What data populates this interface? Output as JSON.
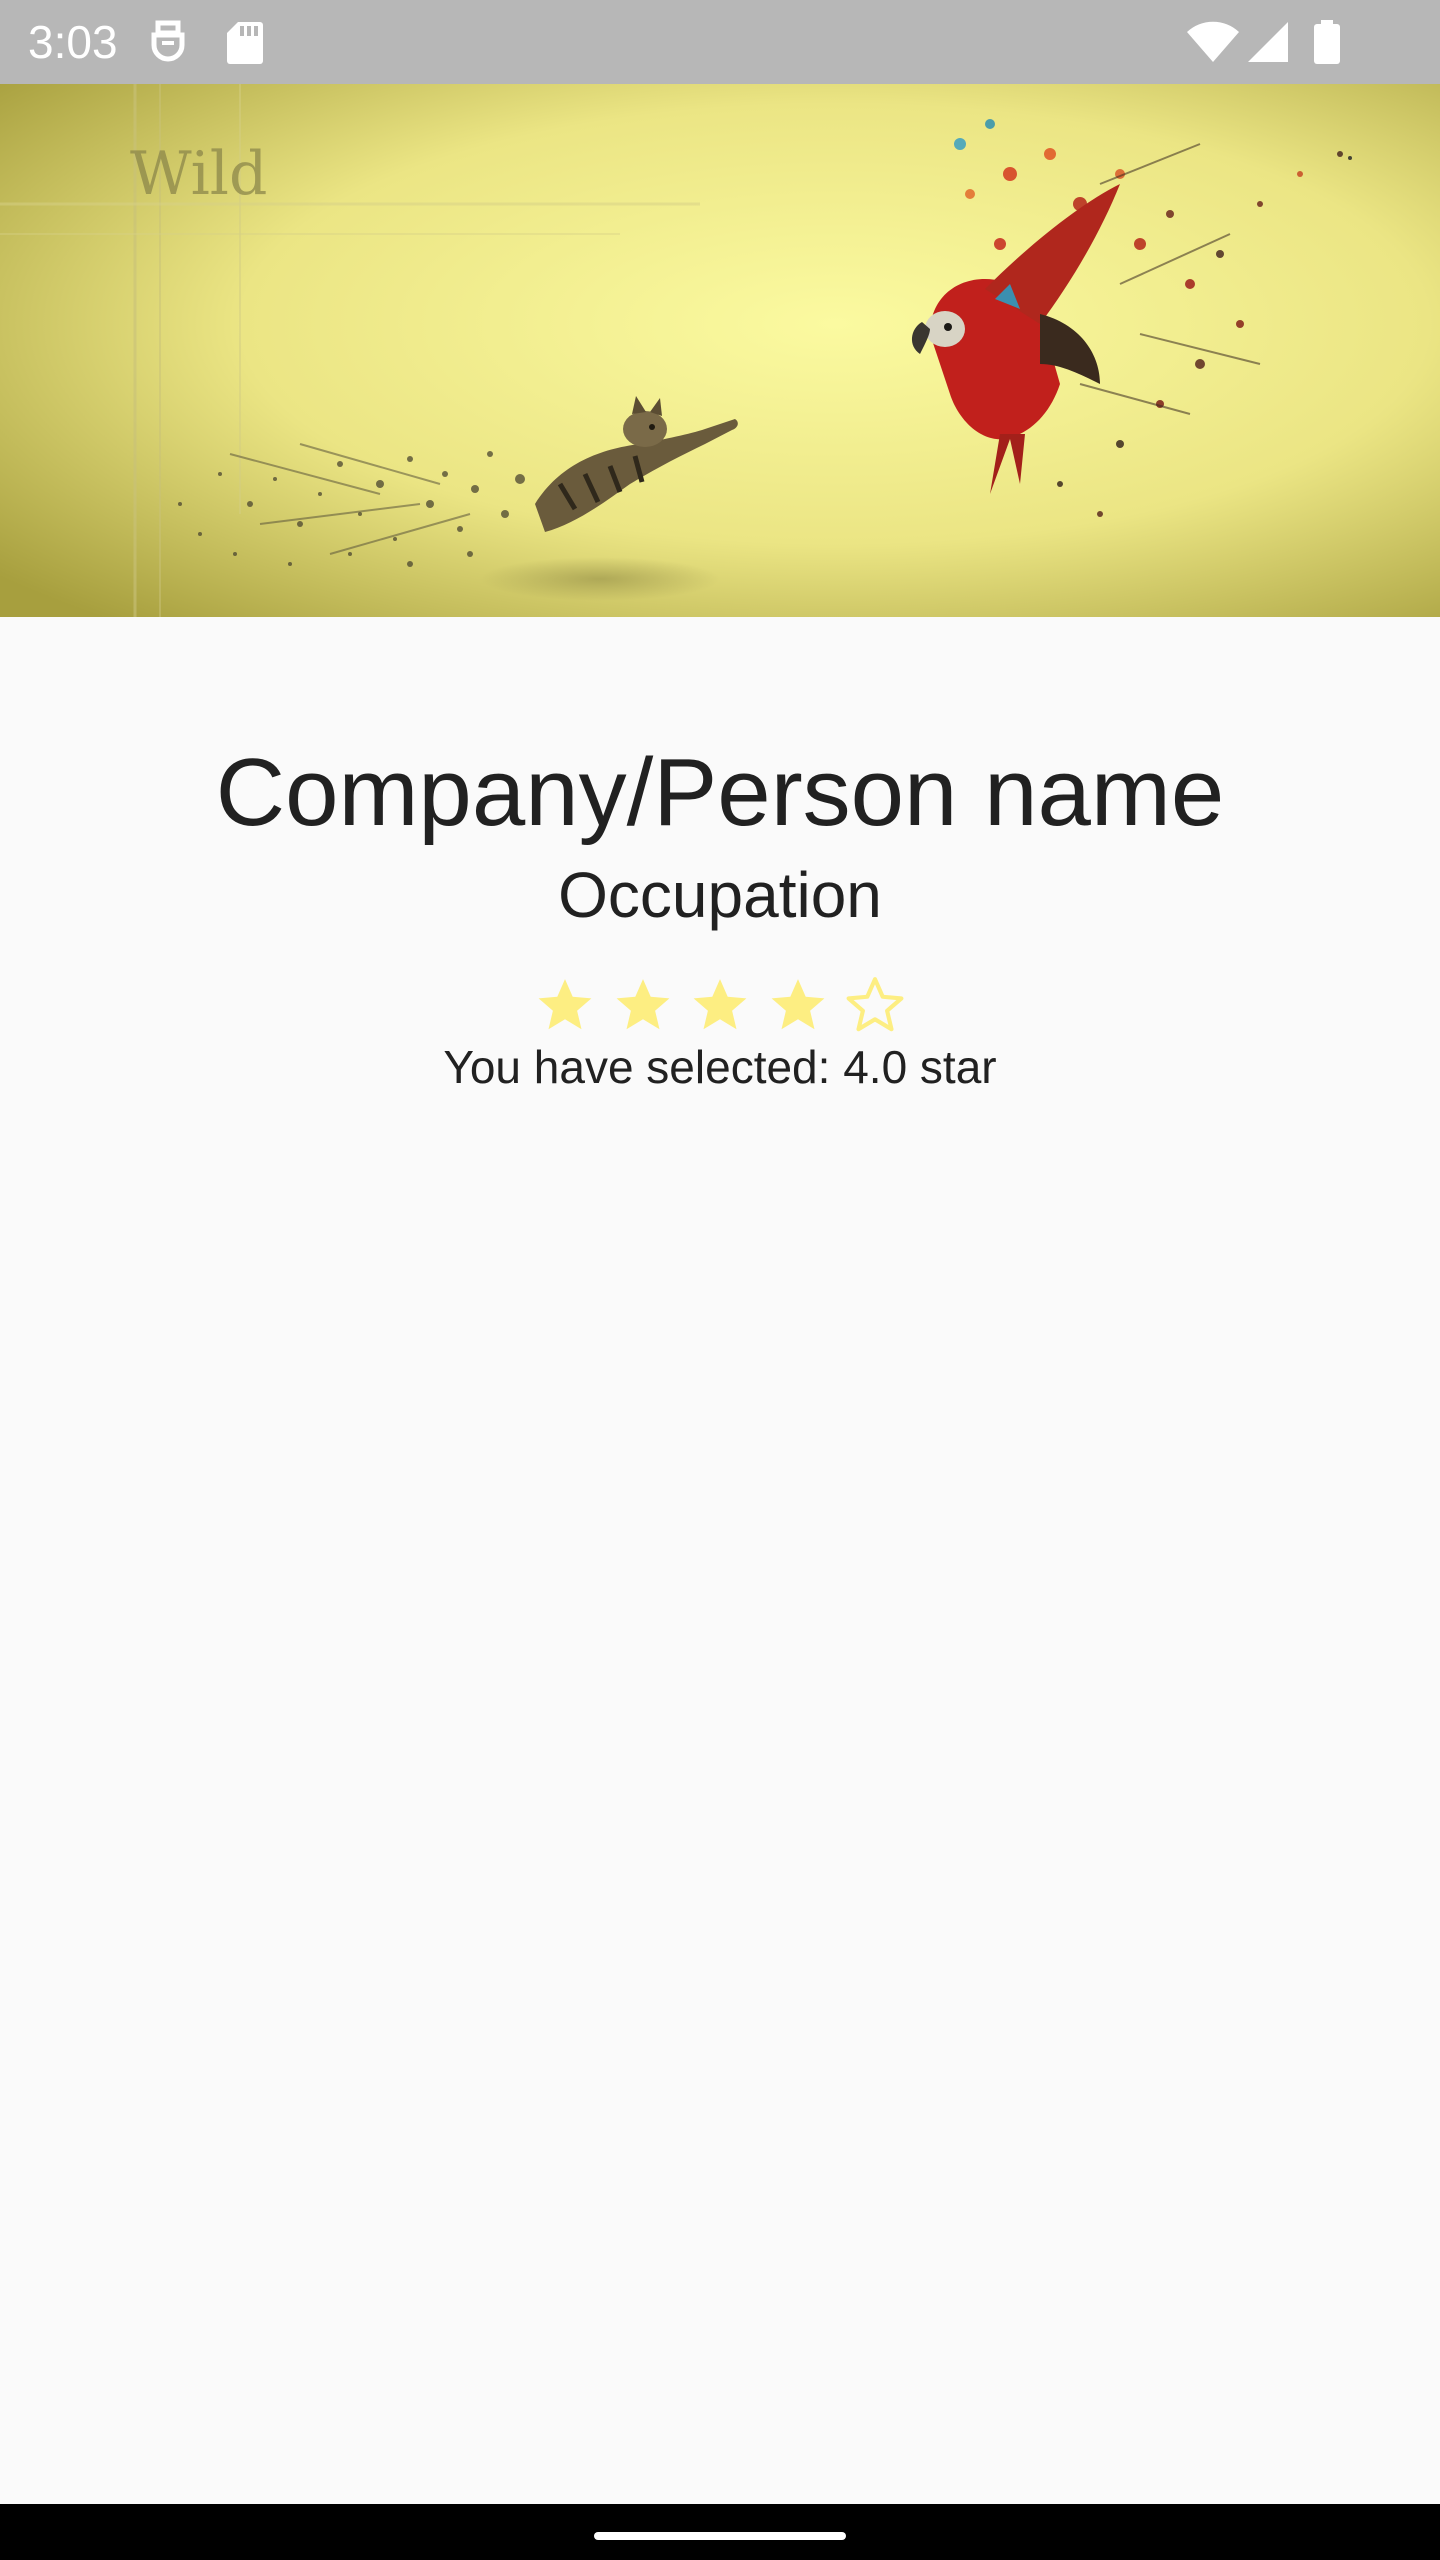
{
  "status_bar": {
    "time": "3:03",
    "icons": [
      "usb-debug-icon",
      "sd-card-icon",
      "wifi-icon",
      "cell-signal-icon",
      "battery-icon"
    ]
  },
  "hero": {
    "watermark_text": "Wild",
    "tint_color": "#f6f08a"
  },
  "profile": {
    "name": "Company/Person name",
    "occupation": "Occupation"
  },
  "rating": {
    "value": 4.0,
    "max": 5,
    "star_color": "#fdee82",
    "label": "You have selected: 4.0 star"
  }
}
